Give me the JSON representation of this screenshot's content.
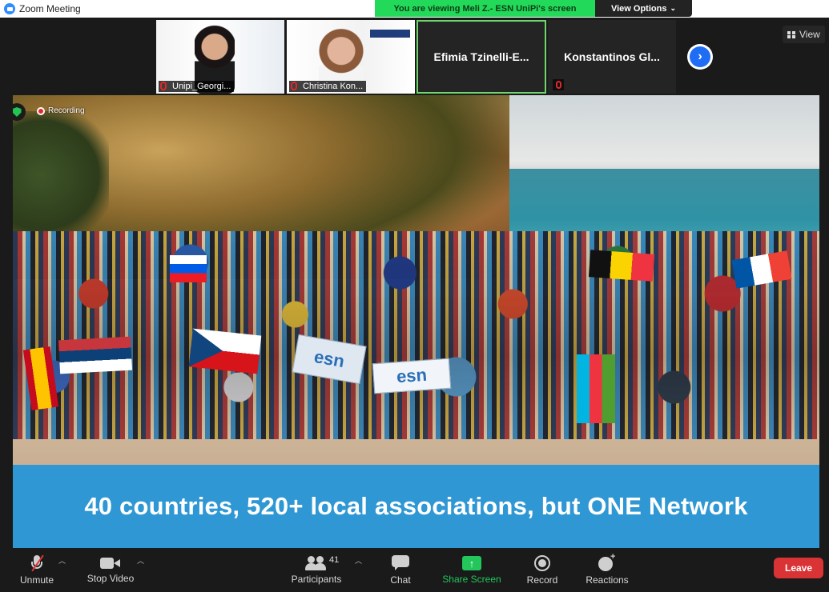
{
  "window": {
    "title": "Zoom Meeting"
  },
  "share_banner": {
    "viewing_text": "You are viewing Meli Z.- ESN UniPi's screen",
    "view_options_label": "View Options"
  },
  "thumbnails": [
    {
      "name": "Unipi_Georgi..."
    },
    {
      "name": "Christina Kon..."
    },
    {
      "name": "Efimia  Tzinelli-E..."
    },
    {
      "name": "Konstantinos  Gl..."
    }
  ],
  "view_button": {
    "label": "View"
  },
  "recording": {
    "label": "Recording"
  },
  "slide": {
    "caption": "40 countries, 520+ local associations, but ONE Network",
    "banner_text": "esn"
  },
  "toolbar": {
    "unmute_label": "Unmute",
    "stop_video_label": "Stop Video",
    "participants_label": "Participants",
    "participants_count": "41",
    "chat_label": "Chat",
    "share_screen_label": "Share Screen",
    "record_label": "Record",
    "reactions_label": "Reactions",
    "leave_label": "Leave"
  },
  "colors": {
    "share_green": "#23d959",
    "leave_red": "#d93335",
    "caption_blue": "#2f97d3",
    "zoom_blue": "#2d8cff"
  }
}
